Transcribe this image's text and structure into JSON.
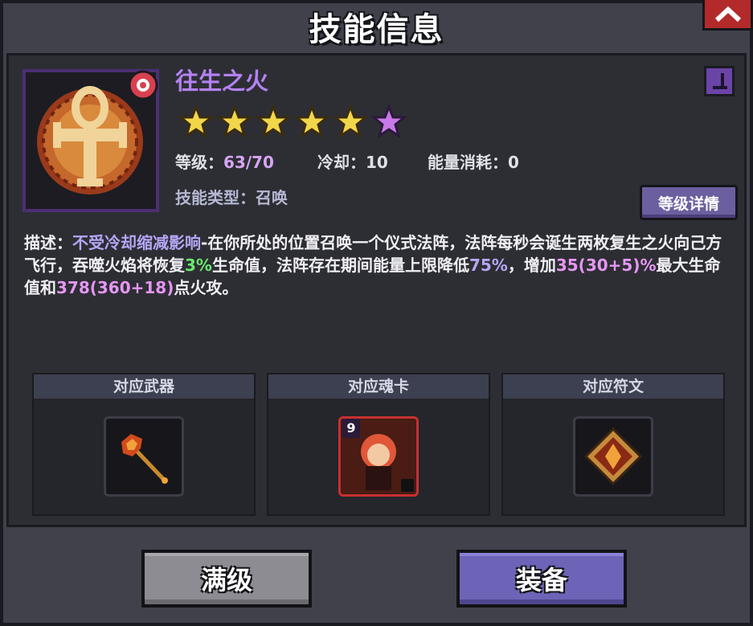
{
  "window": {
    "title": "技能信息"
  },
  "skill": {
    "name": "往生之火",
    "stars_filled": 5,
    "stars_total": 6,
    "level_label": "等级：",
    "level_value": "63/70",
    "cooldown_label": "冷却：",
    "cooldown_value": "10",
    "energy_label": "能量消耗：",
    "energy_value": "0",
    "type_text": "技能类型：召唤",
    "detail_button": "等级详情"
  },
  "description": {
    "label": "描述：",
    "seg_trait": "不受冷却缩减影响",
    "seg_1": "-在你所处的位置召唤一个仪式法阵，法阵每秒会诞生两枚复生之火向己方飞行，吞噬火焰将恢复",
    "seg_heal": "3%",
    "seg_2": "生命值，法阵存在期间能量上限降低",
    "seg_reduce": "75%",
    "seg_3": "，增加",
    "seg_hp": "35(30+5)%",
    "seg_4": "最大生命值和",
    "seg_atk": "378(360+18)",
    "seg_5": "点火攻。"
  },
  "related": {
    "weapon_label": "对应武器",
    "soulcard_label": "对应魂卡",
    "soulcard_level": "9",
    "rune_label": "对应符文"
  },
  "actions": {
    "max_label": "满级",
    "equip_label": "装备"
  },
  "colors": {
    "skill_name": "#b482f2",
    "star_gold": "#f2d64a",
    "star_purple": "#c87ae8",
    "heal_green": "#69e86c",
    "highlight_pink": "#e596f2"
  }
}
